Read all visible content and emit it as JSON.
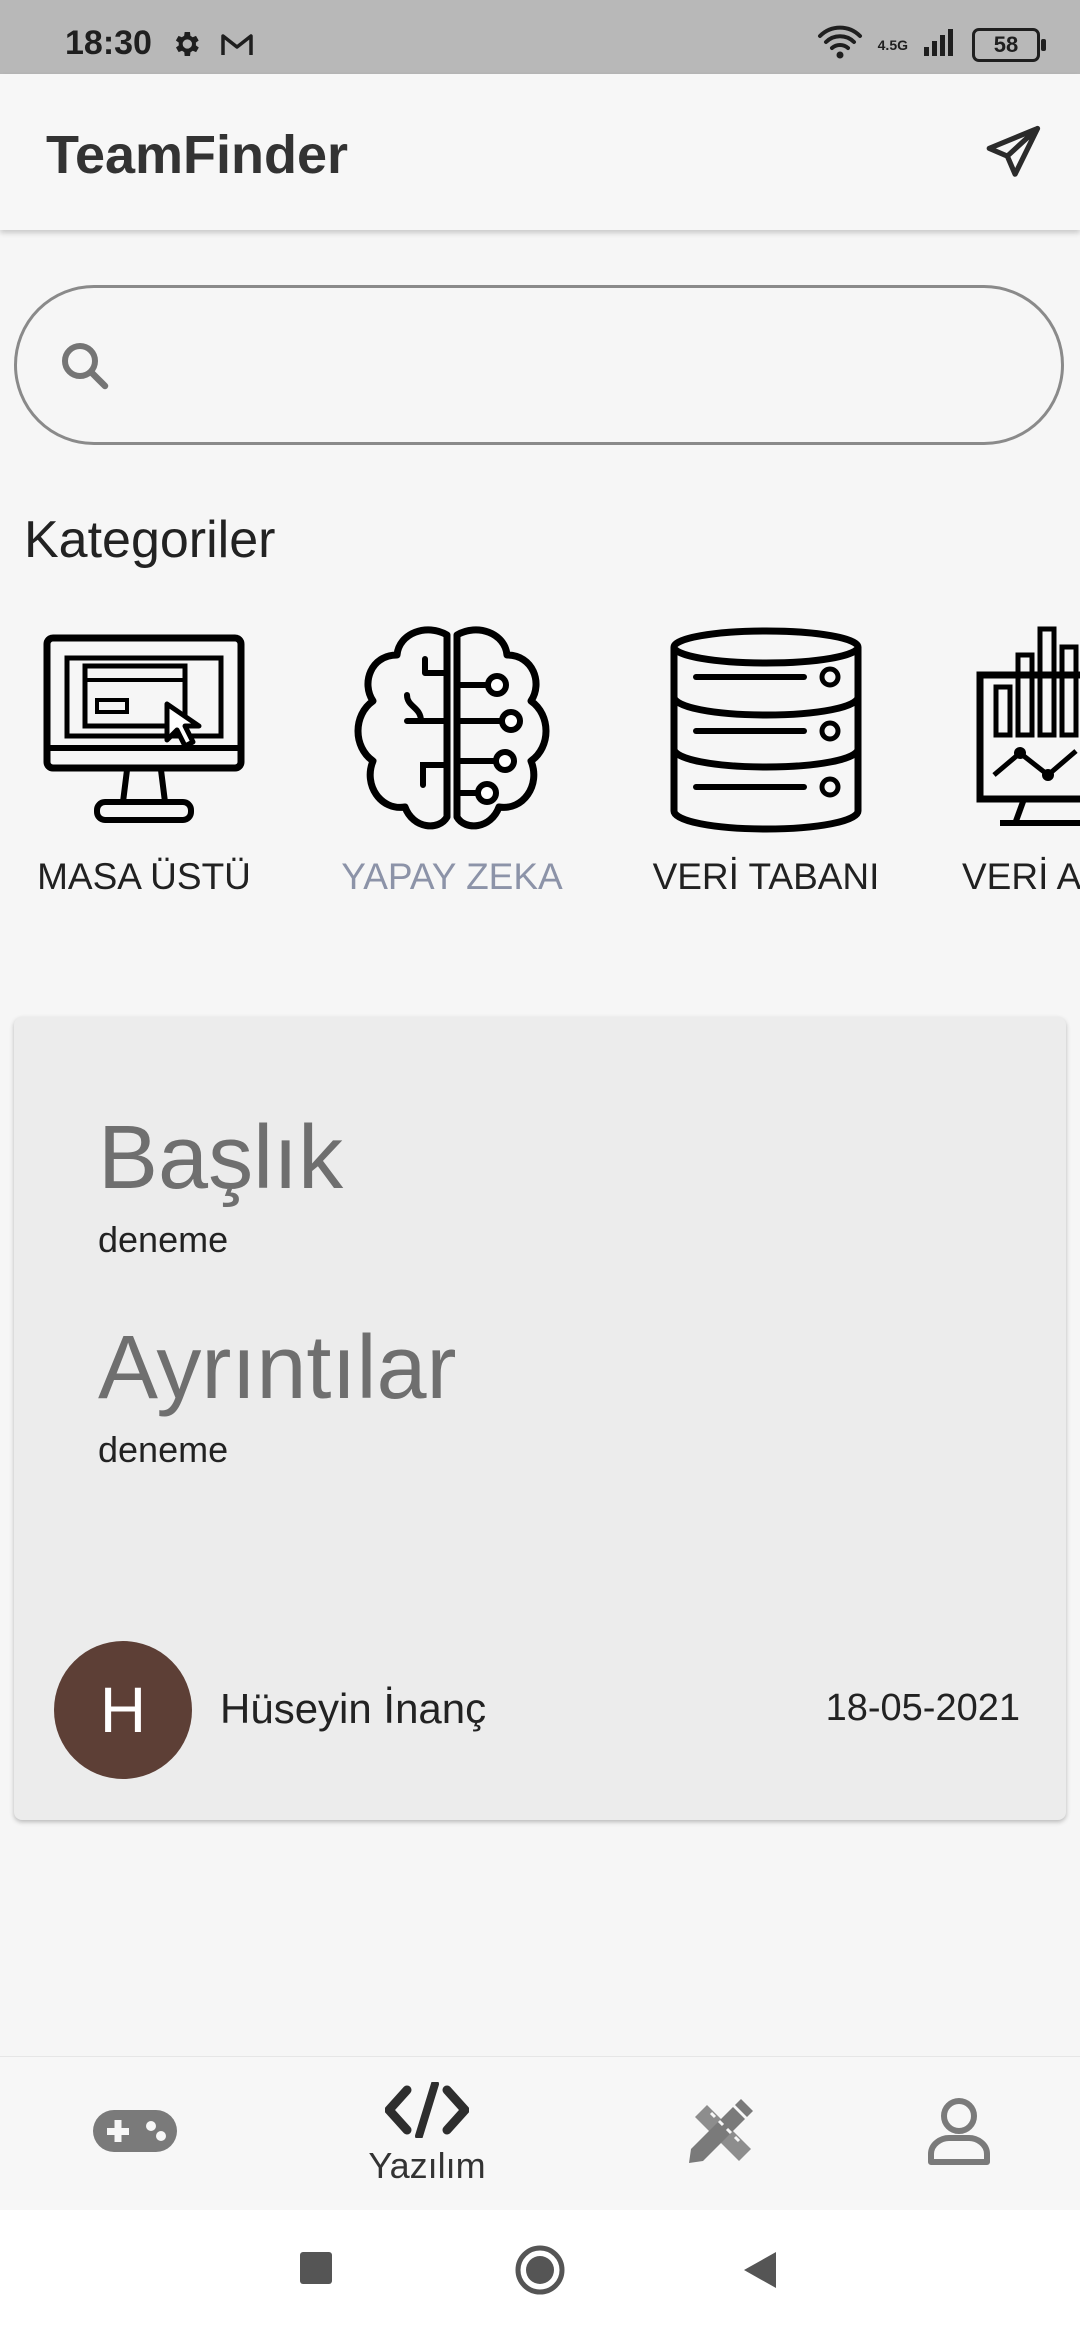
{
  "status_bar": {
    "time": "18:30",
    "network_label": "4.5G",
    "battery": "58"
  },
  "app": {
    "title": "TeamFinder"
  },
  "search": {
    "placeholder": "",
    "value": ""
  },
  "categories": {
    "heading": "Kategoriler",
    "items": [
      {
        "label": "MASA ÜSTÜ",
        "icon": "desktop-monitor-icon"
      },
      {
        "label": "YAPAY ZEKA",
        "icon": "brain-circuit-icon"
      },
      {
        "label": "VERİ TABANI",
        "icon": "database-icon"
      },
      {
        "label": "VERİ A",
        "icon": "data-analytics-icon"
      }
    ]
  },
  "post": {
    "title_label": "Başlık",
    "title_value": "deneme",
    "details_label": "Ayrıntılar",
    "details_value": "deneme",
    "avatar_initial": "H",
    "author": "Hüseyin İnanç",
    "date": "18-05-2021"
  },
  "bottom_nav": {
    "items": [
      {
        "icon": "gamepad-icon",
        "label": ""
      },
      {
        "icon": "code-icon",
        "label": "Yazılım"
      },
      {
        "icon": "design-pencil-ruler-icon",
        "label": ""
      },
      {
        "icon": "user-profile-icon",
        "label": ""
      }
    ]
  },
  "colors": {
    "avatar_bg": "#5d3f36",
    "inactive_category": "#8c93a8",
    "status_bar_bg": "#b8b8b8"
  }
}
